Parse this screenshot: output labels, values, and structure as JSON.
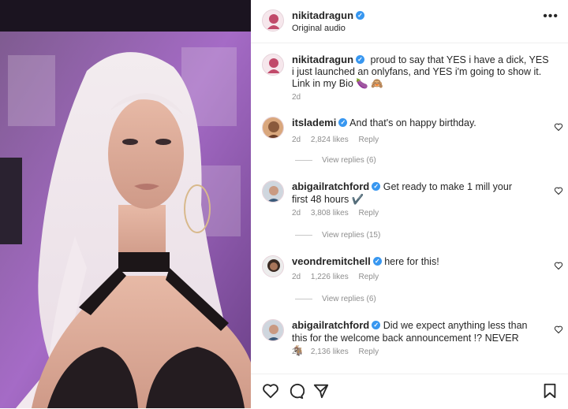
{
  "post": {
    "username": "nikitadragun",
    "audio": "Original audio",
    "more_icon": "more-horizontal-icon",
    "caption": "proud to say that YES i have a dick, YES i just launched an onlyfans, and YES i'm going to show it. Link in my Bio 🍆 🙈",
    "caption_date": "2d"
  },
  "comments": [
    {
      "username": "itslademi",
      "text": "And that's on happy birthday.",
      "date": "2d",
      "likes": "2,824 likes",
      "reply": "Reply",
      "view_replies": "View replies (6)"
    },
    {
      "username": "abigailratchford",
      "text": "Get ready to make 1 mill your first 48 hours ✔️",
      "date": "2d",
      "likes": "3,808 likes",
      "reply": "Reply",
      "view_replies": "View replies (15)"
    },
    {
      "username": "veondremitchell",
      "text": "here for this!",
      "date": "2d",
      "likes": "1,226 likes",
      "reply": "Reply",
      "view_replies": "View replies (6)"
    },
    {
      "username": "abigailratchford",
      "text": "Did we expect anything less than this for the welcome back announcement !? NEVER 🐐",
      "date": "2d",
      "likes": "2,136 likes",
      "reply": "Reply"
    }
  ],
  "icons": {
    "like": "heart-icon",
    "comment": "comment-icon",
    "share": "send-icon",
    "save": "bookmark-icon",
    "verified": "verified-badge-icon"
  },
  "colors": {
    "verified": "#3897f0",
    "muted_text": "#8e8e8e",
    "media_bg": "#8a4fa8"
  }
}
